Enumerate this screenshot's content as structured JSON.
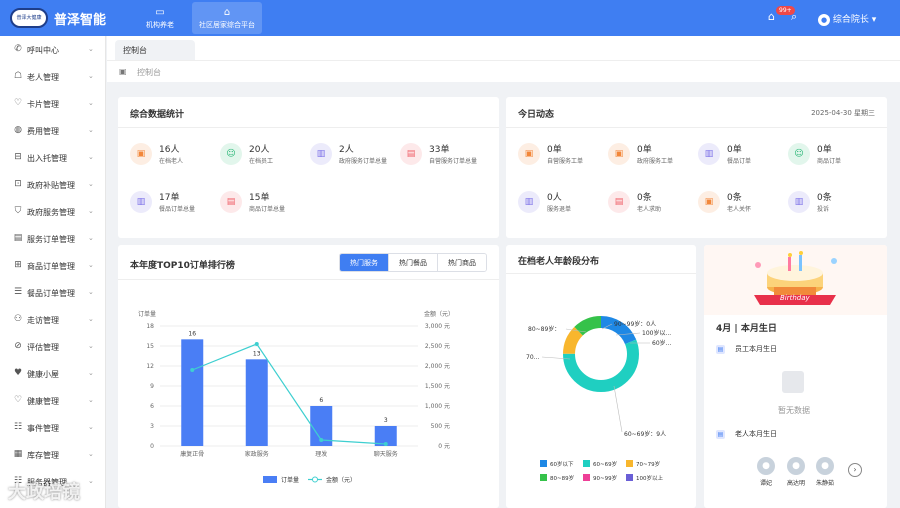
{
  "header": {
    "logo_text": "普泽大健康",
    "brand": "普泽智能",
    "nav": [
      {
        "label": "机构养老",
        "icon": "monitor-icon"
      },
      {
        "label": "社区居家综合平台",
        "icon": "home-icon"
      }
    ],
    "notification_badge": "99+",
    "user_name": "综合院长",
    "accent_color": "#3f7ef2"
  },
  "sidebar": {
    "items": [
      {
        "label": "呼叫中心",
        "icon": "phone-icon"
      },
      {
        "label": "老人管理",
        "icon": "elder-icon"
      },
      {
        "label": "卡片管理",
        "icon": "card-icon"
      },
      {
        "label": "费用管理",
        "icon": "fee-icon"
      },
      {
        "label": "出入托管理",
        "icon": "checkin-icon"
      },
      {
        "label": "政府补贴管理",
        "icon": "subsidy-icon"
      },
      {
        "label": "政府服务管理",
        "icon": "shield-icon"
      },
      {
        "label": "服务订单管理",
        "icon": "service-order-icon"
      },
      {
        "label": "商品订单管理",
        "icon": "goods-order-icon"
      },
      {
        "label": "餐品订单管理",
        "icon": "meal-order-icon"
      },
      {
        "label": "走访管理",
        "icon": "visit-icon"
      },
      {
        "label": "评估管理",
        "icon": "assess-icon"
      },
      {
        "label": "健康小屋",
        "icon": "heart-icon"
      },
      {
        "label": "健康管理",
        "icon": "health-icon"
      },
      {
        "label": "事件管理",
        "icon": "event-icon"
      },
      {
        "label": "库存管理",
        "icon": "stock-icon"
      },
      {
        "label": "服务器管理",
        "icon": "server-icon"
      }
    ]
  },
  "tabs": [
    {
      "label": "控制台"
    }
  ],
  "breadcrumb": "控制台",
  "stats_card": {
    "title": "综合数据统计",
    "items": [
      {
        "value": "16人",
        "label": "在档老人",
        "icon": "elder-icon",
        "color": "orange"
      },
      {
        "value": "20人",
        "label": "在档员工",
        "icon": "staff-icon",
        "color": "green"
      },
      {
        "value": "2人",
        "label": "政府服务订单总量",
        "icon": "gov-order-icon",
        "color": "purple"
      },
      {
        "value": "33单",
        "label": "自营服务订单总量",
        "icon": "self-order-icon",
        "color": "red"
      },
      {
        "value": "17单",
        "label": "餐品订单总量",
        "icon": "meal-icon",
        "color": "purple"
      },
      {
        "value": "15单",
        "label": "商品订单总量",
        "icon": "goods-icon",
        "color": "red"
      }
    ]
  },
  "today_card": {
    "title": "今日动态",
    "date": "2025-04-30 星期三",
    "items": [
      {
        "value": "0单",
        "label": "自营服务工单",
        "icon": "self-work-icon",
        "color": "orange"
      },
      {
        "value": "0单",
        "label": "政府服务工单",
        "icon": "gov-work-icon",
        "color": "orange"
      },
      {
        "value": "0单",
        "label": "餐品订单",
        "icon": "meal-icon",
        "color": "purple"
      },
      {
        "value": "0单",
        "label": "商品订单",
        "icon": "goods-icon",
        "color": "green"
      },
      {
        "value": "0人",
        "label": "服务退单",
        "icon": "refund-icon",
        "color": "purple"
      },
      {
        "value": "0条",
        "label": "老人求助",
        "icon": "help-icon",
        "color": "red"
      },
      {
        "value": "0条",
        "label": "老人关怀",
        "icon": "care-icon",
        "color": "orange"
      },
      {
        "value": "0条",
        "label": "投诉",
        "icon": "complaint-icon",
        "color": "purple"
      }
    ]
  },
  "ranking_card": {
    "title": "本年度TOP10订单排行榜",
    "toggles": [
      "热门服务",
      "热门餐品",
      "热门商品"
    ],
    "active_toggle": 0
  },
  "age_card": {
    "title": "在档老人年龄段分布"
  },
  "birthday_card": {
    "banner_text": "Birthday",
    "title": "4月 | 本月生日",
    "staff_label": "员工本月生日",
    "empty_text": "暂无数据",
    "elder_label": "老人本月生日",
    "people": [
      "谭妃",
      "高达明",
      "朱静茹"
    ]
  },
  "watermark": "大政培镜",
  "chart_data": [
    {
      "type": "bar",
      "title": "本年度TOP10订单排行榜",
      "categories": [
        "康复正骨",
        "家政服务",
        "理发",
        "聊天服务"
      ],
      "series": [
        {
          "name": "订单量",
          "type": "bar",
          "axis": "left",
          "values": [
            16,
            13,
            6,
            3
          ],
          "color": "#4a7ef5"
        },
        {
          "name": "金额（元）",
          "type": "line",
          "axis": "right",
          "values": [
            1900,
            2550,
            150,
            50
          ],
          "color": "#3ecfd0"
        }
      ],
      "ylabel": "订单量",
      "ylim": [
        0,
        18
      ],
      "yticks": [
        0,
        3,
        6,
        9,
        12,
        15,
        18
      ],
      "y2label": "金额（元）",
      "y2lim": [
        0,
        3000
      ],
      "y2ticks": [
        "0 元",
        "500 元",
        "1,000 元",
        "1,500 元",
        "2,000 元",
        "2,500 元",
        "3,000 元"
      ],
      "grid": true,
      "legend": "bottom"
    },
    {
      "type": "pie",
      "title": "在档老人年龄段分布",
      "donut": true,
      "slices": [
        {
          "label": "60岁以下",
          "value": 3,
          "color": "#1e88e5"
        },
        {
          "label": "60~69岁",
          "value": 9,
          "color": "#1fcfc1"
        },
        {
          "label": "70~79岁",
          "value": 2,
          "color": "#f8b62d"
        },
        {
          "label": "80~89岁",
          "value": 2,
          "color": "#35c24a"
        },
        {
          "label": "90~99岁",
          "value": 0,
          "color": "#ee3f97"
        },
        {
          "label": "100岁以上",
          "value": 0,
          "color": "#6a5fd6"
        }
      ],
      "callouts": [
        "60~69岁：9人",
        "80~89岁：",
        "90~99岁：0人",
        "100岁以...",
        "60岁...",
        "70..."
      ],
      "legend": "bottom"
    }
  ]
}
